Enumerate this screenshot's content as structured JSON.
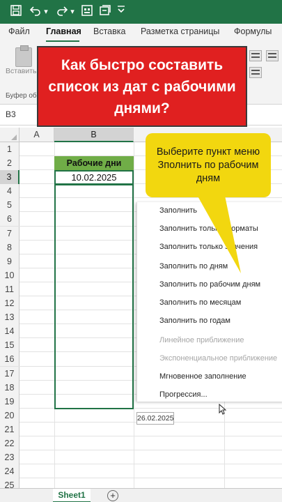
{
  "colors": {
    "excel_green": "#217346",
    "banner_red": "#e02020",
    "callout_yellow": "#f2d70f",
    "header_green": "#70ad47"
  },
  "titlebar": {
    "icons": [
      "save-icon",
      "undo-icon",
      "dropdown-chevron-icon",
      "redo-icon",
      "dropdown-chevron-icon",
      "macro-icon",
      "quick-access-icon",
      "customize-chevron-icon"
    ],
    "dropdown_glyph": "▾"
  },
  "ribbon": {
    "tabs": [
      "Файл",
      "Главная",
      "Вставка",
      "Разметка страницы",
      "Формулы"
    ],
    "paste_label": "Вставить",
    "clipboard_group": "Буфер об"
  },
  "banner": {
    "text": "Как быстро составить список из дат с рабочими днями?"
  },
  "formula_bar": {
    "name_box": "B3"
  },
  "sheet": {
    "columns": [
      "A",
      "B"
    ],
    "rows": [
      "1",
      "2",
      "3",
      "4",
      "5",
      "6",
      "7",
      "8",
      "9",
      "10",
      "11",
      "12",
      "13",
      "14",
      "15",
      "16",
      "17",
      "18",
      "19",
      "20",
      "21",
      "22",
      "23",
      "24",
      "25"
    ],
    "selected_row": "3",
    "header_cell": "Рабочие дни",
    "date_cell": "10.02.2025",
    "fill_tooltip": "26.02.2025",
    "tab_name": "Sheet1",
    "add_sheet_glyph": "+"
  },
  "context_menu": {
    "items": [
      {
        "label": "Заполнить",
        "enabled": true
      },
      {
        "label": "Заполнить только форматы",
        "enabled": true
      },
      {
        "label": "Заполнить только значения",
        "enabled": true
      },
      {
        "label": "Заполнить по дням",
        "enabled": true
      },
      {
        "label": "Заполнить по рабочим дням",
        "enabled": true
      },
      {
        "label": "Заполнить по месяцам",
        "enabled": true
      },
      {
        "label": "Заполнить по годам",
        "enabled": true
      },
      {
        "label": "Линейное приближение",
        "enabled": false
      },
      {
        "label": "Экспоненциальное приближение",
        "enabled": false
      },
      {
        "label": "Мгновенное заполнение",
        "enabled": true
      },
      {
        "label": "Прогрессия...",
        "enabled": true
      }
    ]
  },
  "callout": {
    "text": "Выберите пункт меню Зполнить по рабочим дням"
  }
}
